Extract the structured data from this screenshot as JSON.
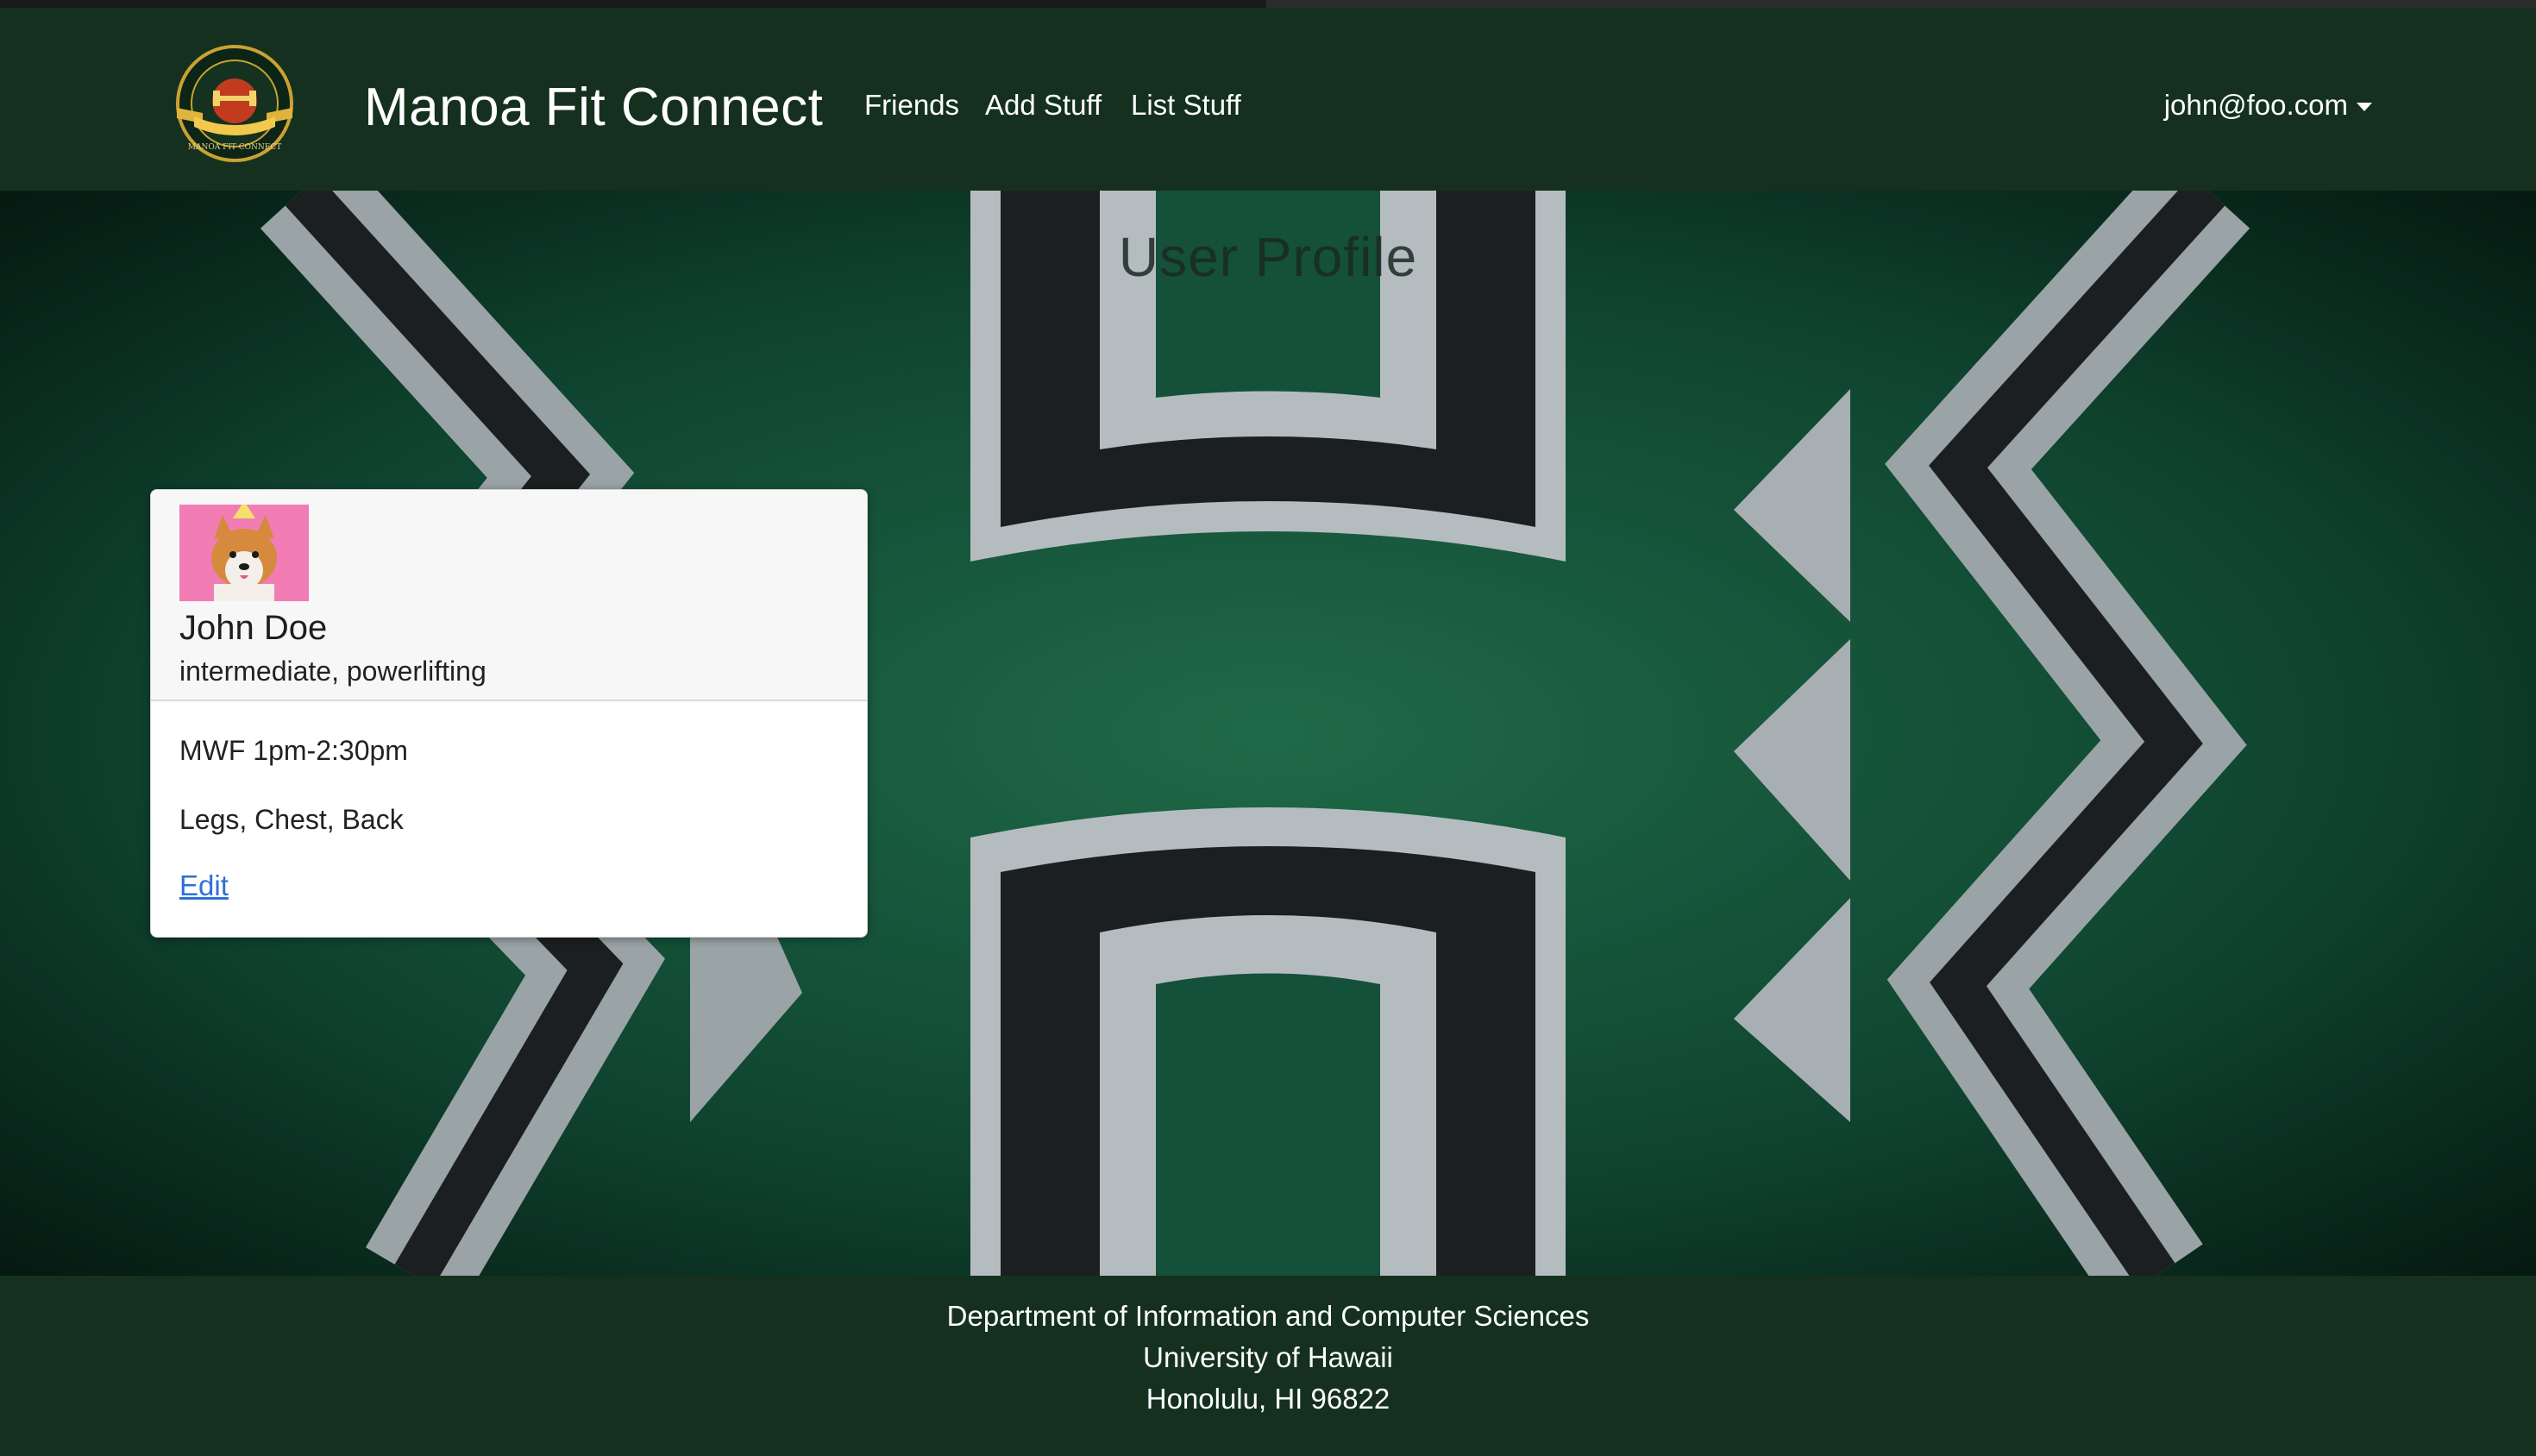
{
  "navbar": {
    "brand": "Manoa Fit Connect",
    "links": [
      {
        "label": "Friends"
      },
      {
        "label": "Add Stuff"
      },
      {
        "label": "List Stuff"
      }
    ],
    "user": "john@foo.com",
    "logo_icon": "manoa-fit-connect-seal",
    "logo_text": "MANOA FIT CONNECT"
  },
  "page": {
    "heading": "User Profile"
  },
  "profile": {
    "name": "John Doe",
    "subtitle": "intermediate, powerlifting",
    "schedule": "MWF 1pm-2:30pm",
    "focus": "Legs, Chest, Back",
    "edit_label": "Edit",
    "avatar_icon": "corgi-party-hat-photo"
  },
  "footer": {
    "line1": "Department of Information and Computer Sciences",
    "line2": "University of Hawaii",
    "line3": "Honolulu, HI 96822"
  },
  "colors": {
    "navbar": "#15301f",
    "background": "#0d3a28",
    "link": "#2f6fd6"
  }
}
